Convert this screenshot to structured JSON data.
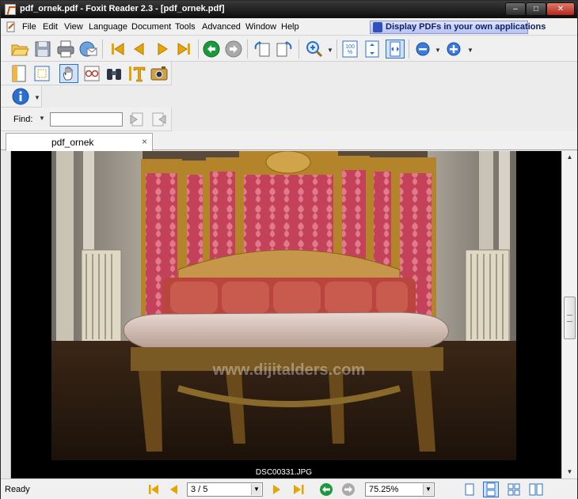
{
  "window": {
    "title": "pdf_ornek.pdf - Foxit Reader 2.3 - [pdf_ornek.pdf]",
    "controls": {
      "minimize": "–",
      "maximize": "□",
      "close": "✕"
    }
  },
  "menu": {
    "items": [
      "File",
      "Edit",
      "View",
      "Language",
      "Document",
      "Tools",
      "Advanced",
      "Window",
      "Help"
    ],
    "promo": "Display PDFs in your own applications"
  },
  "toolbar": {
    "buttons": [
      "open-icon",
      "save-icon",
      "print-icon",
      "email-icon",
      "first-page-icon",
      "previous-page-icon",
      "next-page-icon",
      "last-page-icon",
      "go-back-icon",
      "go-forward-icon",
      "rotate-left-icon",
      "rotate-right-icon",
      "zoom-in-tool-icon",
      "actual-size-icon",
      "fit-page-icon",
      "fit-width-icon",
      "zoom-out-icon",
      "zoom-in-icon",
      "bookmark-panel-icon",
      "select-area-icon",
      "hand-tool-icon",
      "text-select-glasses-icon",
      "find-binoculars-icon",
      "select-text-icon",
      "snapshot-icon",
      "info-icon"
    ]
  },
  "find": {
    "label": "Find:",
    "value": "",
    "placeholder": ""
  },
  "tab": {
    "label": "pdf_ornek",
    "close": "×"
  },
  "document": {
    "caption": "DSC00331.JPG",
    "watermark": "www.dijitalders.com"
  },
  "status": {
    "text": "Ready",
    "page": "3 / 5",
    "page_current": 3,
    "page_total": 5,
    "zoom": "75.25%"
  },
  "colors": {
    "accent": "#2a6fd0",
    "nav_arrow": "#e8a400",
    "go_green": "#1a9a3a",
    "title_bar": "#0c0c0c"
  }
}
